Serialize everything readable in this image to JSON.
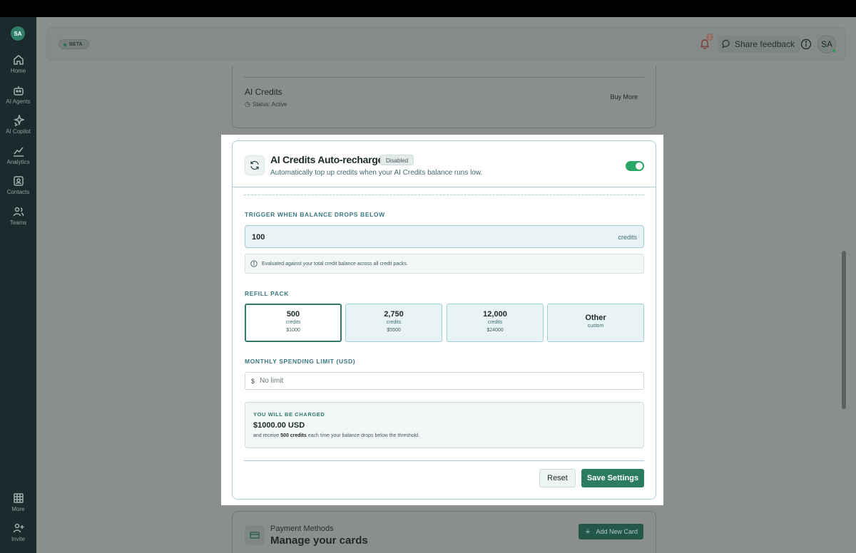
{
  "sidebar": {
    "avatar": "SA",
    "items": [
      {
        "label": "Home",
        "icon": "home-icon"
      },
      {
        "label": "AI Agents",
        "icon": "robot-icon"
      },
      {
        "label": "AI Copilot",
        "icon": "sparkle-icon"
      },
      {
        "label": "Analytics",
        "icon": "chart-icon"
      },
      {
        "label": "Contacts",
        "icon": "contact-icon"
      },
      {
        "label": "Teams",
        "icon": "users-icon"
      }
    ],
    "bottom_items": [
      {
        "label": "More",
        "icon": "grid-icon"
      },
      {
        "label": "Invite",
        "icon": "user-plus-icon"
      }
    ]
  },
  "header": {
    "beta": "BETA",
    "notification_count": "1",
    "share_feedback": "Share feedback",
    "avatar": "SA"
  },
  "credits_card": {
    "title": "AI Credits",
    "status": "Status: Active",
    "buy_more": "Buy More"
  },
  "modal": {
    "title": "AI Credits Auto-recharge",
    "badge": "Disabled",
    "subtitle": "Automatically top up credits when your AI Credits balance runs low.",
    "toggle_on": true,
    "trigger": {
      "label": "TRIGGER WHEN BALANCE DROPS BELOW",
      "value": "100",
      "unit": "credits",
      "note": "Evaluated against your total credit balance across all credit packs."
    },
    "refill": {
      "label": "REFILL PACK",
      "packs": [
        {
          "amount": "500",
          "unit": "credits",
          "price": "$1000",
          "selected": true
        },
        {
          "amount": "2,750",
          "unit": "credits",
          "price": "$5500",
          "selected": false
        },
        {
          "amount": "12,000",
          "unit": "credits",
          "price": "$24000",
          "selected": false
        },
        {
          "amount": "Other",
          "unit": "custom",
          "price": "",
          "selected": false
        }
      ]
    },
    "limit": {
      "label": "MONTHLY SPENDING LIMIT (USD)",
      "currency": "$",
      "placeholder": "No limit"
    },
    "charge": {
      "heading": "YOU WILL BE CHARGED",
      "amount": "$1000.00 USD",
      "desc_pre": "and receive",
      "desc_bold": "500 credits",
      "desc_post": "each time your balance drops below the threshold."
    },
    "reset": "Reset",
    "save": "Save Settings"
  },
  "payment_card": {
    "label": "Payment Methods",
    "title": "Manage your cards",
    "add_button": "Add New Card"
  },
  "colors": {
    "accent": "#2b7c62",
    "toggle": "#2aa665",
    "sidebar": "#1b2a2c"
  }
}
